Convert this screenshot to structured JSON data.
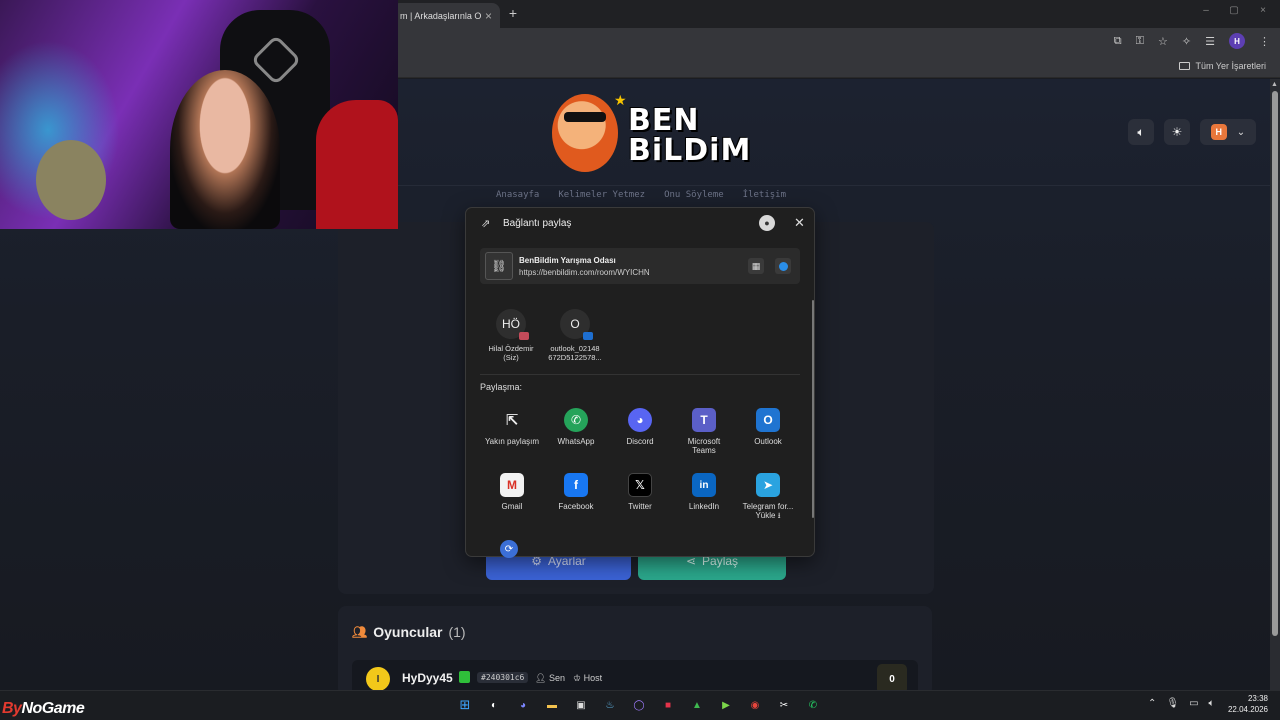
{
  "browser": {
    "tab_title": "m | Arkadaşlarınla Onl",
    "tab_close": "×",
    "new_tab": "+",
    "win_min": "–",
    "win_max": "▢",
    "win_close": "×",
    "bookmarks_label": "Tüm Yer İşaretleri",
    "profile_initial": "H"
  },
  "header": {
    "logo_line1": "BEN",
    "logo_line2": "BiLDiM",
    "user_initial": "H",
    "nav": [
      "Anasayfa",
      "Kelimeler Yetmez",
      "Onu Söyleme",
      "İletişim"
    ]
  },
  "main": {
    "settings_label": "Ayarlar",
    "share_label": "Paylaş"
  },
  "players": {
    "title": "Oyuncular",
    "count": "(1)",
    "row": {
      "avatar_initial": "I",
      "name": "HyDyy45",
      "id": "#240301c6",
      "you_label": "Sen",
      "host_label": "Host",
      "score": "0"
    }
  },
  "share_dialog": {
    "title": "Bağlantı paylaş",
    "link_title": "BenBildim Yarışma Odası",
    "link_url": "https://benbildim.com/room/WYICHN",
    "contacts": [
      {
        "initials": "HÖ",
        "label_1": "Hilal Özdemir",
        "label_2": "(Siz)"
      },
      {
        "initials": "O",
        "label_1": "outlook_02148",
        "label_2": "672D5122578..."
      }
    ],
    "share_with_label": "Paylaşma:",
    "apps": [
      {
        "label_1": "Yakın paylaşım",
        "label_2": ""
      },
      {
        "label_1": "WhatsApp",
        "label_2": ""
      },
      {
        "label_1": "Discord",
        "label_2": ""
      },
      {
        "label_1": "Microsoft",
        "label_2": "Teams"
      },
      {
        "label_1": "Outlook",
        "label_2": ""
      },
      {
        "label_1": "Gmail",
        "label_2": ""
      },
      {
        "label_1": "Facebook",
        "label_2": ""
      },
      {
        "label_1": "Twitter",
        "label_2": ""
      },
      {
        "label_1": "LinkedIn",
        "label_2": ""
      },
      {
        "label_1": "Telegram for...",
        "label_2": "Yükle ⭳"
      }
    ]
  },
  "taskbar": {
    "brand_prefix": "By",
    "brand_rest": "NoGame",
    "time": "23:38",
    "date": "22.04.2026"
  },
  "colors": {
    "settings_button": "#3b63d6",
    "share_button": "#2ba88c",
    "accent_orange": "#e9773b"
  }
}
